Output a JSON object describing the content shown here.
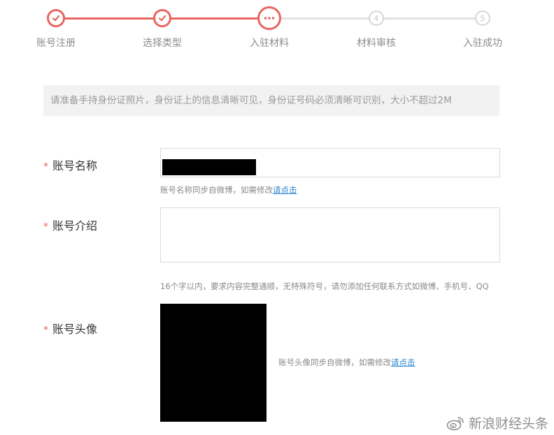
{
  "steps": [
    {
      "label": "账号注册",
      "state": "done",
      "number": ""
    },
    {
      "label": "选择类型",
      "state": "done",
      "number": ""
    },
    {
      "label": "入驻材料",
      "state": "current",
      "number": ""
    },
    {
      "label": "材料审核",
      "state": "todo",
      "number": "4"
    },
    {
      "label": "入驻成功",
      "state": "todo",
      "number": "5"
    }
  ],
  "notice": "请准备手持身份证照片，身份证上的信息清晰可见，身份证号码必须清晰可识别，大小不超过2M",
  "form": {
    "required_mark": "*",
    "account_name": {
      "label": "账号名称",
      "hint_text": "账号名称同步自微博，如需修改",
      "hint_link": "请点击"
    },
    "account_intro": {
      "label": "账号介绍",
      "value": "",
      "hint_text": "16个字以内，要求内容完整通顺，无特殊符号，请勿添加任何联系方式如微博、手机号、QQ"
    },
    "account_avatar": {
      "label": "账号头像",
      "hint_text": "账号头像同步自微博，如需修改",
      "hint_link": "请点击"
    }
  },
  "watermark": "新浪财经头条",
  "colors": {
    "accent": "#e8665f",
    "link": "#2b87d3",
    "inactive": "#d6d6d6"
  }
}
